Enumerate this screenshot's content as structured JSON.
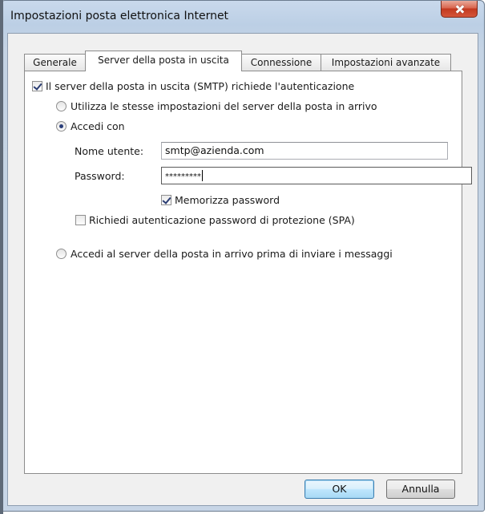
{
  "window": {
    "title": "Impostazioni posta elettronica Internet"
  },
  "tabs": [
    {
      "label": "Generale",
      "active": false
    },
    {
      "label": "Server della posta in uscita",
      "active": true
    },
    {
      "label": "Connessione",
      "active": false
    },
    {
      "label": "Impostazioni avanzate",
      "active": false
    }
  ],
  "smtp_auth": {
    "checkbox_label": "Il server della posta in uscita (SMTP) richiede l'autenticazione",
    "checked": true,
    "use_same_settings_label": "Utilizza le stesse impostazioni del server della posta in arrivo",
    "use_same_settings_selected": false,
    "login_with_label": "Accedi con",
    "login_with_selected": true,
    "username_label": "Nome utente:",
    "username_value": "smtp@azienda.com",
    "password_label": "Password:",
    "password_value": "*********",
    "remember_password_label": "Memorizza password",
    "remember_password_checked": true,
    "spa_label": "Richiedi autenticazione password di protezione (SPA)",
    "spa_checked": false,
    "login_incoming_first_label": "Accedi al server della posta in arrivo prima di inviare i messaggi",
    "login_incoming_first_selected": false
  },
  "buttons": {
    "ok_label": "OK",
    "cancel_label": "Annulla"
  },
  "icons": {
    "close": "close-icon"
  },
  "colors": {
    "title_bar": "#c4d5ea",
    "close_button": "#c9462c",
    "default_button_border": "#3c7fb1"
  }
}
